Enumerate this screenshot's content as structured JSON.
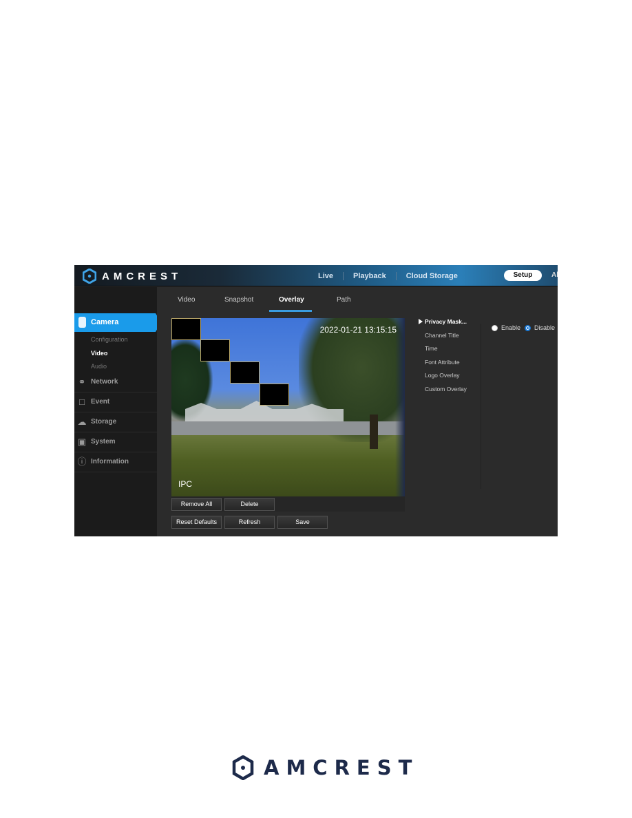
{
  "app": {
    "brand": "AMCREST",
    "nav": [
      "Live",
      "Playback",
      "Cloud Storage"
    ],
    "setup_label": "Setup",
    "nav_overflow": "Al"
  },
  "sidebar": {
    "active_section": "Camera",
    "camera_subitems": [
      {
        "label": "Configuration",
        "active": false
      },
      {
        "label": "Video",
        "active": true
      },
      {
        "label": "Audio",
        "active": false
      }
    ],
    "items": [
      {
        "label": "Network",
        "icon": "network-icon"
      },
      {
        "label": "Event",
        "icon": "event-icon"
      },
      {
        "label": "Storage",
        "icon": "storage-icon"
      },
      {
        "label": "System",
        "icon": "system-icon"
      },
      {
        "label": "Information",
        "icon": "information-icon"
      }
    ]
  },
  "tabs": [
    {
      "label": "Video",
      "active": false
    },
    {
      "label": "Snapshot",
      "active": false
    },
    {
      "label": "Overlay",
      "active": true
    },
    {
      "label": "Path",
      "active": false
    }
  ],
  "video": {
    "osd_time": "2022-01-21 13:15:15",
    "osd_channel": "IPC",
    "privacy_masks_count": 4
  },
  "buttons": {
    "remove_all": "Remove All",
    "delete": "Delete",
    "reset_defaults": "Reset Defaults",
    "refresh": "Refresh",
    "save": "Save"
  },
  "overlay_menu": [
    {
      "label": "Privacy Mask...",
      "active": true
    },
    {
      "label": "Channel Title",
      "active": false
    },
    {
      "label": "Time",
      "active": false
    },
    {
      "label": "Font Attribute",
      "active": false
    },
    {
      "label": "Logo Overlay",
      "active": false
    },
    {
      "label": "Custom Overlay",
      "active": false
    }
  ],
  "privacy_mask": {
    "options": [
      "Enable",
      "Disable"
    ],
    "selected": "Disable"
  },
  "footer": {
    "brand": "AMCREST"
  },
  "colors": {
    "accent": "#1a9bea",
    "tab_underline": "#3a9be0",
    "footer_brand": "#1d2a4a"
  }
}
